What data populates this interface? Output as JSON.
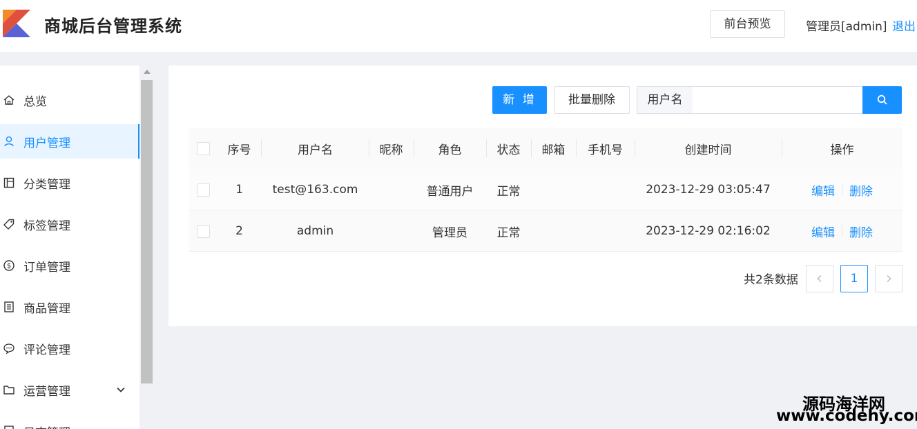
{
  "header": {
    "app_title": "商城后台管理系统",
    "preview_label": "前台预览",
    "admin_label": "管理员[admin]",
    "logout_label": "退出",
    "logo_colors": [
      "#f28b2c",
      "#e0503f",
      "#5b62d6"
    ]
  },
  "sidebar": {
    "items": [
      {
        "label": "总览",
        "icon": "home-icon"
      },
      {
        "label": "用户管理",
        "icon": "user-icon",
        "active": true
      },
      {
        "label": "分类管理",
        "icon": "layout-icon"
      },
      {
        "label": "标签管理",
        "icon": "tag-icon"
      },
      {
        "label": "订单管理",
        "icon": "dollar-circle-icon"
      },
      {
        "label": "商品管理",
        "icon": "list-box-icon"
      },
      {
        "label": "评论管理",
        "icon": "comment-icon"
      },
      {
        "label": "运营管理",
        "icon": "folder-icon",
        "expandable": true
      },
      {
        "label": "日志管理",
        "icon": "log-icon",
        "expandable": true
      }
    ]
  },
  "toolbar": {
    "add_label": "新 增",
    "batch_delete_label": "批量删除",
    "search_label": "用户名",
    "search_value": "",
    "search_icon": "search-icon"
  },
  "table": {
    "columns": [
      "序号",
      "用户名",
      "昵称",
      "角色",
      "状态",
      "邮箱",
      "手机号",
      "创建时间",
      "操作"
    ],
    "rows": [
      {
        "index": "1",
        "username": "test@163.com",
        "nickname": "",
        "role": "普通用户",
        "status": "正常",
        "email": "",
        "phone": "",
        "created": "2023-12-29 03:05:47",
        "edit": "编辑",
        "delete": "删除"
      },
      {
        "index": "2",
        "username": "admin",
        "nickname": "",
        "role": "管理员",
        "status": "正常",
        "email": "",
        "phone": "",
        "created": "2023-12-29 02:16:02",
        "edit": "编辑",
        "delete": "删除"
      }
    ]
  },
  "pagination": {
    "total_label": "共2条数据",
    "current_page": "1"
  },
  "watermark": {
    "cn": "源码海洋网",
    "en": "www.codehy.com"
  },
  "colors": {
    "accent": "#1890ff",
    "active_bg": "#e8f4ff",
    "background": "#f0f1f5"
  }
}
